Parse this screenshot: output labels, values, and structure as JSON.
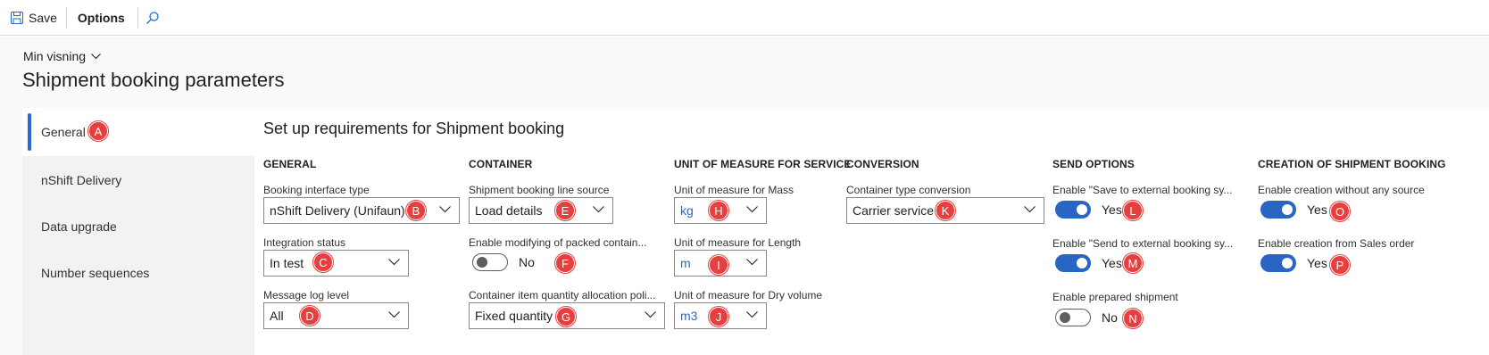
{
  "toolbar": {
    "save_label": "Save",
    "options_label": "Options"
  },
  "header": {
    "view_label": "Min visning",
    "title": "Shipment booking parameters"
  },
  "nav": {
    "items": [
      {
        "label": "General"
      },
      {
        "label": "nShift Delivery"
      },
      {
        "label": "Data upgrade"
      },
      {
        "label": "Number sequences"
      }
    ]
  },
  "main": {
    "section_title": "Set up requirements for Shipment booking",
    "general": {
      "heading": "GENERAL",
      "booking_interface_label": "Booking interface type",
      "booking_interface_value": "nShift Delivery (Unifaun)",
      "integration_status_label": "Integration status",
      "integration_status_value": "In test",
      "message_log_label": "Message log level",
      "message_log_value": "All"
    },
    "container": {
      "heading": "CONTAINER",
      "line_source_label": "Shipment booking line source",
      "line_source_value": "Load details",
      "modify_packed_label": "Enable modifying of packed contain...",
      "modify_packed_value": "No",
      "allocation_label": "Container item quantity allocation poli...",
      "allocation_value": "Fixed quantity"
    },
    "uom": {
      "heading": "UNIT OF MEASURE FOR SERVICE",
      "mass_label": "Unit of measure for Mass",
      "mass_value": "kg",
      "length_label": "Unit of measure for Length",
      "length_value": "m",
      "volume_label": "Unit of measure for Dry volume",
      "volume_value": "m3"
    },
    "conversion": {
      "heading": "CONVERSION",
      "container_type_label": "Container type conversion",
      "container_type_value": "Carrier service"
    },
    "send_options": {
      "heading": "SEND OPTIONS",
      "save_external_label": "Enable \"Save to external booking sy...",
      "save_external_value": "Yes",
      "send_external_label": "Enable \"Send to external booking sy...",
      "send_external_value": "Yes",
      "prepared_label": "Enable prepared shipment",
      "prepared_value": "No"
    },
    "creation": {
      "heading": "CREATION OF SHIPMENT BOOKING",
      "without_source_label": "Enable creation without any source",
      "without_source_value": "Yes",
      "from_sales_label": "Enable creation from Sales order",
      "from_sales_value": "Yes"
    }
  },
  "badges": [
    "A",
    "B",
    "C",
    "D",
    "E",
    "F",
    "G",
    "H",
    "I",
    "J",
    "K",
    "L",
    "M",
    "N",
    "O",
    "P"
  ],
  "colors": {
    "accent": "#2966c4",
    "badge": "#e63f3f"
  }
}
